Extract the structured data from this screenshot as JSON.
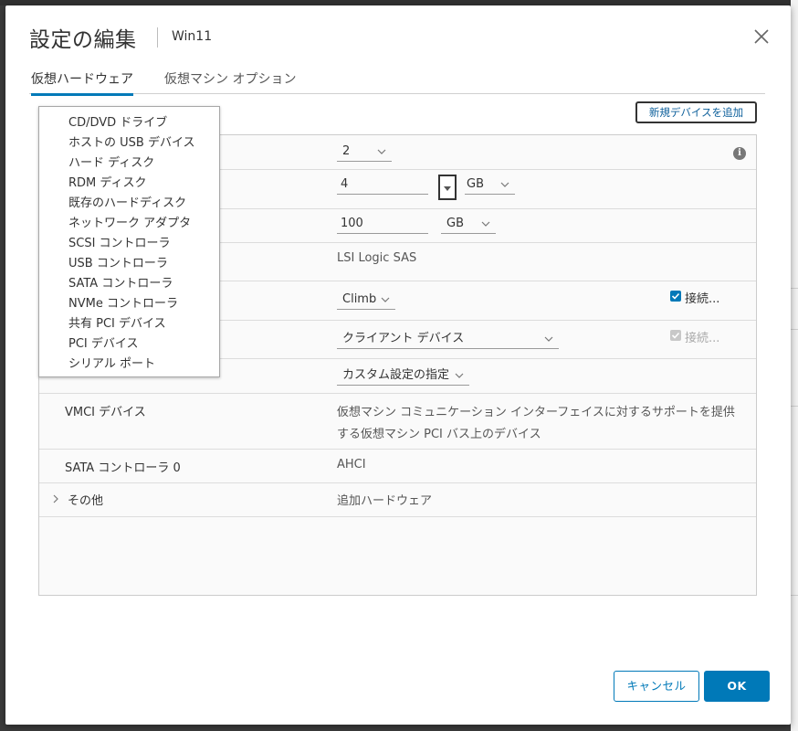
{
  "dialog": {
    "title": "設定の編集",
    "subtitle": "Win11",
    "tabs": [
      {
        "label": "仮想ハードウェア",
        "active": true
      },
      {
        "label": "仮想マシン オプション",
        "active": false
      }
    ],
    "add_device_label": "新規デバイスを追加"
  },
  "rows": {
    "cpu": {
      "value": "2"
    },
    "memory": {
      "value": "4",
      "unit": "GB"
    },
    "harddisk": {
      "value": "100",
      "unit": "GB"
    },
    "scsi": {
      "value": "LSI Logic SAS"
    },
    "network": {
      "value": "Climb",
      "connect_label": "接続..."
    },
    "cd": {
      "value": "クライアント デバイス",
      "connect_label": "接続..."
    },
    "video": {
      "value": "カスタム設定の指定"
    },
    "vmci": {
      "label": "VMCI デバイス",
      "value_line1": "仮想マシン コミュニケーション インターフェイスに対するサポートを提供",
      "value_line2": "する仮想マシン PCI バス上のデバイス"
    },
    "sata": {
      "label": "SATA コントローラ 0",
      "value": "AHCI"
    },
    "other": {
      "label": "その他",
      "value": "追加ハードウェア"
    }
  },
  "menu": {
    "items": [
      "CD/DVD ドライブ",
      "ホストの USB デバイス",
      "ハード ディスク",
      "RDM ディスク",
      "既存のハードディスク",
      "ネットワーク アダプタ",
      "SCSI コントローラ",
      "USB コントローラ",
      "SATA コントローラ",
      "NVMe コントローラ",
      "共有 PCI デバイス",
      "PCI デバイス",
      "シリアル ポート"
    ]
  },
  "footer": {
    "cancel_label": "キャンセル",
    "ok_label": "OK"
  },
  "colors": {
    "accent": "#0079b8",
    "overlay": "#3b3b3b"
  },
  "icons": [
    "close-icon",
    "info-icon",
    "chevron-down-icon",
    "chevron-right-icon",
    "checkbox-icon"
  ]
}
